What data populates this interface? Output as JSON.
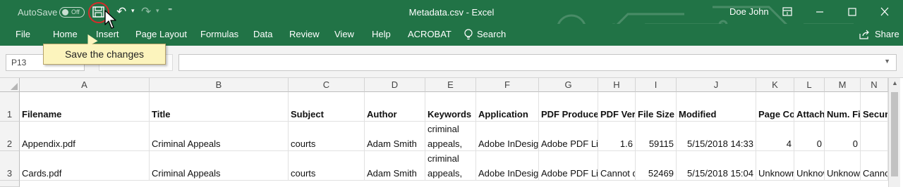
{
  "title_bar": {
    "autosave_label": "AutoSave",
    "autosave_state": "Off",
    "window_title": "Metadata.csv  -  Excel",
    "user_name": "Doe John",
    "customize_glyph": "⁼"
  },
  "ribbon": {
    "tabs": [
      "File",
      "Home",
      "Insert",
      "Page Layout",
      "Formulas",
      "Data",
      "Review",
      "View",
      "Help",
      "ACROBAT"
    ],
    "search_label": "Search",
    "share_label": "Share"
  },
  "tooltip": {
    "text": "Save the changes"
  },
  "formula_bar": {
    "name_box": "P13",
    "formula": ""
  },
  "sheet": {
    "columns": [
      "A",
      "B",
      "C",
      "D",
      "E",
      "F",
      "G",
      "H",
      "I",
      "J",
      "K",
      "L",
      "M",
      "N"
    ],
    "rows": [
      {
        "num": "1",
        "cells": [
          "Filename",
          "Title",
          "Subject",
          "Author",
          "Keywords",
          "Application",
          "PDF Producer",
          "PDF Version",
          "File Size",
          "Modified",
          "Page Count",
          "Attachments",
          "Num. Files",
          "Security"
        ]
      },
      {
        "num": "2",
        "cells": [
          "Appendix.pdf",
          "Criminal Appeals",
          "courts",
          "Adam Smith",
          "criminal appeals,",
          "Adobe InDesign",
          "Adobe PDF Library",
          "1.6",
          "59115",
          "5/15/2018 14:33",
          "4",
          "0",
          "0",
          ""
        ]
      },
      {
        "num": "3",
        "cells": [
          "Cards.pdf",
          "Criminal Appeals",
          "courts",
          "Adam Smith",
          "criminal appeals,",
          "Adobe InDesign",
          "Adobe PDF Library",
          "Cannot determine",
          "52469",
          "5/15/2018 15:04",
          "Unknown",
          "Unknown",
          "Unknown",
          "Cannot"
        ]
      }
    ]
  },
  "colors": {
    "excel_green": "#217346",
    "tooltip_bg": "#fcf4bd",
    "highlight_ring": "#d62b2b"
  }
}
